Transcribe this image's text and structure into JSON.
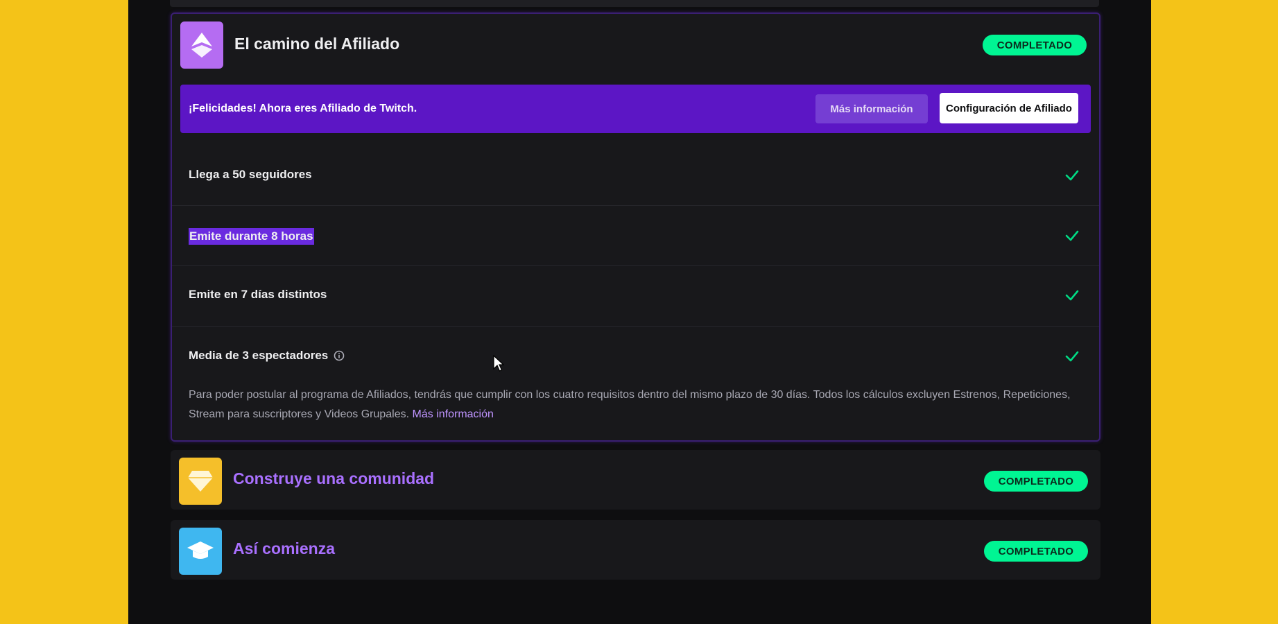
{
  "affiliate_card": {
    "title": "El camino del Afiliado",
    "status": "COMPLETADO",
    "banner": {
      "text": "¡Felicidades! Ahora eres Afiliado de Twitch.",
      "more_info_button": "Más información",
      "config_button": "Configuración de Afiliado"
    },
    "requirements": [
      {
        "label": "Llega a 50 seguidores",
        "done": true
      },
      {
        "label": "Emite durante 8 horas",
        "done": true,
        "highlighted": true
      },
      {
        "label": "Emite en 7 días distintos",
        "done": true
      },
      {
        "label": "Media de 3 espectadores",
        "done": true,
        "has_info_icon": true
      }
    ],
    "footnote": "Para poder postular al programa de Afiliados, tendrás que cumplir con los cuatro requisitos dentro del mismo plazo de 30 días. Todos los cálculos excluyen Estrenos, Repeticiones, Stream para suscriptores y Videos Grupales.",
    "footnote_link": "Más información"
  },
  "community_card": {
    "title": "Construye una comunidad",
    "status": "COMPLETADO"
  },
  "start_card": {
    "title": "Así comienza",
    "status": "COMPLETADO"
  },
  "icons": {
    "affiliate": "affiliate-badge-icon",
    "community": "diamond-icon",
    "start": "graduation-cap-icon",
    "check": "check-icon",
    "info": "info-icon"
  },
  "colors": {
    "accent_purple": "#9147ff",
    "banner_purple": "#5c16c5",
    "status_green": "#00f593",
    "link_purple": "#bf94ff",
    "background_yellow": "#f4c318"
  }
}
